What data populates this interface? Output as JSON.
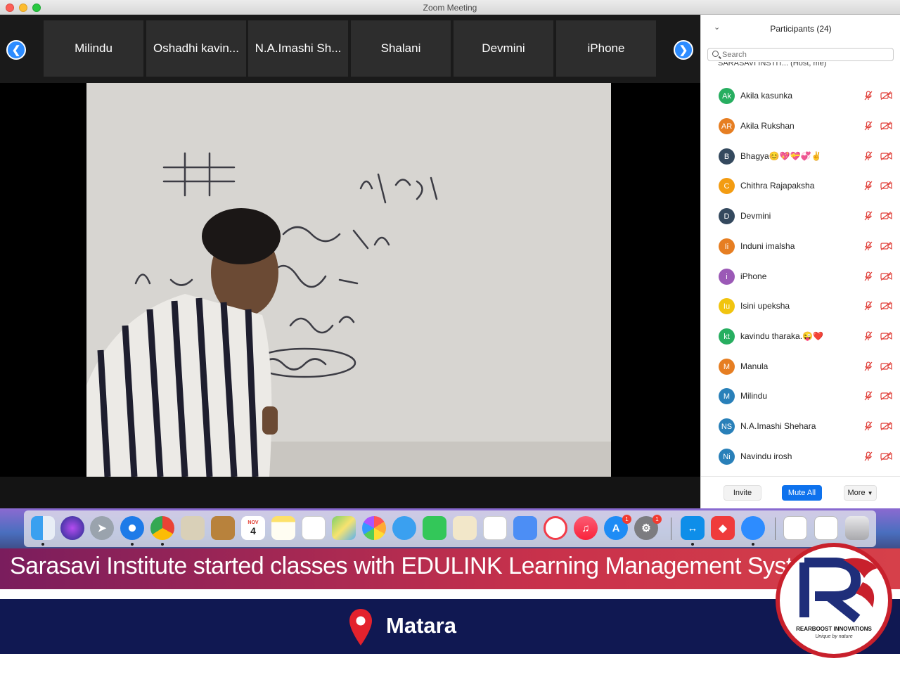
{
  "window": {
    "title": "Zoom Meeting"
  },
  "video_strip": {
    "tiles": [
      "Milindu",
      "Oshadhi kavin...",
      "N.A.Imashi Sh...",
      "Shalani",
      "Devmini",
      "iPhone"
    ]
  },
  "panel": {
    "title": "Participants (24)",
    "search_placeholder": "Search",
    "host_row": "SARASAVI INSTIT...  (Host, me)",
    "participants": [
      {
        "initials": "Ak",
        "name": "Akila kasunka",
        "color": "#27ae60"
      },
      {
        "initials": "AR",
        "name": "Akila Rukshan",
        "color": "#e67e22"
      },
      {
        "initials": "B",
        "name": "Bhagya😊💖💝💞✌️",
        "color": "#34495e"
      },
      {
        "initials": "C",
        "name": "Chithra Rajapaksha",
        "color": "#f39c12"
      },
      {
        "initials": "D",
        "name": "Devmini",
        "color": "#34495e"
      },
      {
        "initials": "Ii",
        "name": "Induni imalsha",
        "color": "#e67e22"
      },
      {
        "initials": "i",
        "name": "iPhone",
        "color": "#9b59b6"
      },
      {
        "initials": "Iu",
        "name": "Isini upeksha",
        "color": "#f1c40f"
      },
      {
        "initials": "kt",
        "name": "kavindu tharaka.😜❤️",
        "color": "#27ae60"
      },
      {
        "initials": "M",
        "name": "Manula",
        "color": "#e67e22"
      },
      {
        "initials": "M",
        "name": "Milindu",
        "color": "#2980b9"
      },
      {
        "initials": "NS",
        "name": "N.A.Imashi Shehara",
        "color": "#2980b9"
      },
      {
        "initials": "Ni",
        "name": "Navindu irosh",
        "color": "#2980b9"
      }
    ],
    "invite_label": "Invite",
    "mute_all_label": "Mute All",
    "more_label": "More"
  },
  "dock": {
    "calendar_month": "NOV",
    "calendar_day": "4",
    "app_store_badge": "1",
    "settings_badge": "1"
  },
  "banner": {
    "headline": "Sarasavi Institute started classes with EDULINK  Learning Management System",
    "location": "Matara",
    "logo_name": "REARBOOST INNOVATIONS",
    "logo_tagline": "Unique by nature"
  },
  "colors": {
    "zoom_blue": "#2d8cff",
    "mute_all_blue": "#0e72ed",
    "muted_red": "#e0403a",
    "banner_navy": "#101852"
  }
}
